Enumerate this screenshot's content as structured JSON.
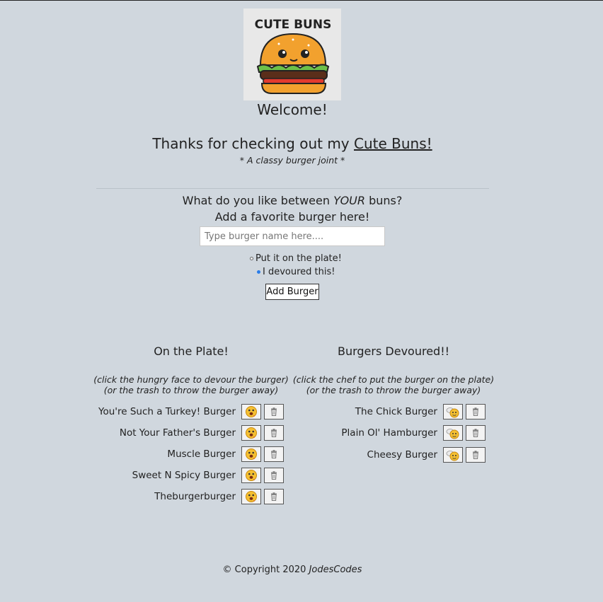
{
  "header": {
    "logo_text": "CUTE BUNS",
    "welcome": "Welcome!",
    "thanks_prefix": "Thanks for checking out my",
    "thanks_link": "Cute Buns!",
    "tagline": "* A classy burger joint *"
  },
  "form": {
    "question_prefix": "What do you like between",
    "question_emph": "YOUR",
    "question_suffix": "buns?",
    "subtitle": "Add a favorite burger here!",
    "input_placeholder": "Type burger name here....",
    "input_value": "",
    "radio_plate_label": "Put it on the plate!",
    "radio_devoured_label": "I devoured this!",
    "selected_option": "I devoured this!",
    "submit_label": "Add Burger"
  },
  "plate": {
    "title": "On the Plate!",
    "hint_1": "(click the hungry face to devour the burger)",
    "hint_2": "(or the trash to throw the burger away)",
    "action_icon": "hungry-face-icon",
    "items": [
      "You're Such a Turkey! Burger",
      "Not Your Father's Burger",
      "Muscle Burger",
      "Sweet N Spicy Burger",
      "Theburgerburger"
    ]
  },
  "devoured": {
    "title": "Burgers Devoured!!",
    "hint_1": "(click the chef to put the burger on the plate)",
    "hint_2": "(or the trash to throw the burger away)",
    "action_icon": "chef-icon",
    "items": [
      "The Chick Burger",
      "Plain Ol' Hamburger",
      "Cheesy Burger"
    ]
  },
  "footer": {
    "copyright": "© Copyright 2020",
    "author": "JodesCodes"
  },
  "colors": {
    "background": "#d0d7de",
    "radio_selected": "#2b7de9"
  }
}
